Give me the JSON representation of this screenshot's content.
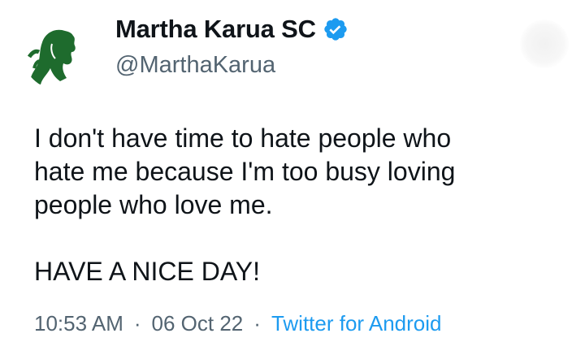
{
  "author": {
    "display_name": "Martha Karua SC",
    "handle": "@MarthaKarua",
    "verified_icon": "verified-badge-icon",
    "avatar_icon": "profile-silhouette-icon"
  },
  "tweet": {
    "line1": "I don't have time to hate people who",
    "line2": "hate me because I'm too busy loving",
    "line3": "people who love me.",
    "line4": "HAVE A NICE DAY!"
  },
  "meta": {
    "time": "10:53 AM",
    "separator": "·",
    "date": "06 Oct 22",
    "source": "Twitter for Android"
  },
  "colors": {
    "text": "#0f1419",
    "muted": "#536471",
    "link": "#1d9bf0",
    "verified": "#1d9bf0",
    "avatar_green": "#1e6b2d"
  }
}
